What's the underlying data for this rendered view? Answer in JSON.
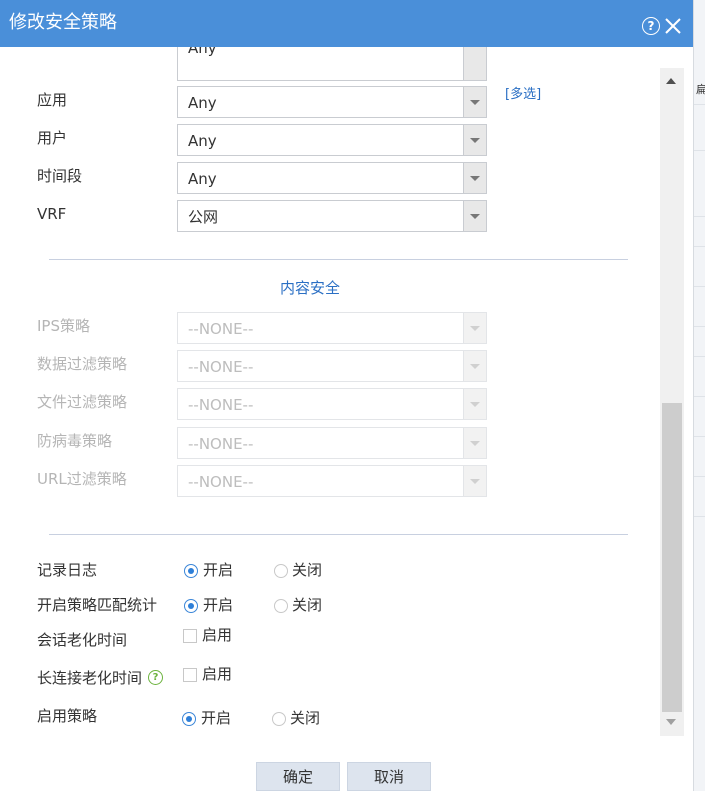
{
  "dialog": {
    "title": "修改安全策略",
    "help_icon": "question-circle-icon",
    "close_icon": "close-icon"
  },
  "colors": {
    "titlebar": "#4a8fd9",
    "link": "#2a6fc4",
    "radio_selected": "#2e7fd8"
  },
  "background": {
    "right_edge_text": "扁"
  },
  "fields": {
    "top_partial_value": "Any",
    "app_label": "应用",
    "app_value": "Any",
    "multi_select_link": "[多选]",
    "user_label": "用户",
    "user_value": "Any",
    "time_label": "时间段",
    "time_value": "Any",
    "vrf_label": "VRF",
    "vrf_value": "公网"
  },
  "content_security": {
    "title": "内容安全",
    "ips_label": "IPS策略",
    "ips_value": "--NONE--",
    "data_filter_label": "数据过滤策略",
    "data_filter_value": "--NONE--",
    "file_filter_label": "文件过滤策略",
    "file_filter_value": "--NONE--",
    "antivirus_label": "防病毒策略",
    "antivirus_value": "--NONE--",
    "url_filter_label": "URL过滤策略",
    "url_filter_value": "--NONE--"
  },
  "options": {
    "log_label": "记录日志",
    "match_stats_label": "开启策略匹配统计",
    "session_aging_label": "会话老化时间",
    "long_conn_aging_label": "长连接老化时间",
    "enable_policy_label": "启用策略",
    "on": "开启",
    "off": "关闭",
    "enable": "启用",
    "help_icon": "green-question-icon"
  },
  "footer": {
    "ok": "确定",
    "cancel": "取消"
  }
}
